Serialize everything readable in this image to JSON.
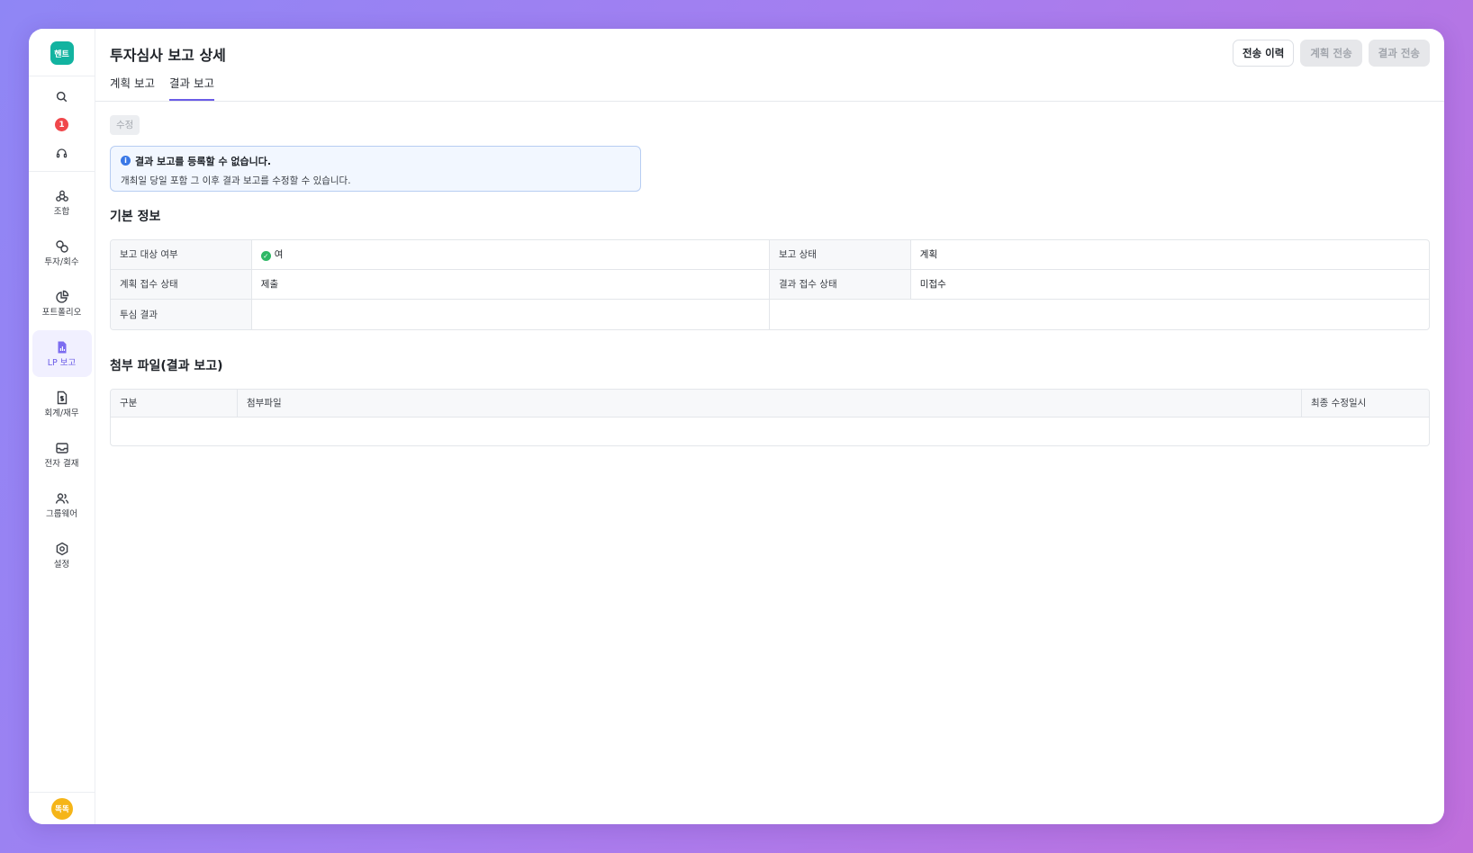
{
  "app": {
    "logo_text": "헨트",
    "notification_count": "1",
    "avatar_text": "똑똑",
    "accent_color": "#6b5ce7",
    "logo_color": "#12b3a0"
  },
  "sidebar": {
    "util_icons": [
      "search-icon",
      "notification-badge",
      "headset-icon"
    ],
    "items": [
      {
        "label": "조합",
        "icon": "union-icon"
      },
      {
        "label": "투자/회수",
        "icon": "investment-icon"
      },
      {
        "label": "포트폴리오",
        "icon": "pie-chart-icon"
      },
      {
        "label": "LP 보고",
        "icon": "report-icon",
        "active": true
      },
      {
        "label": "회계/재무",
        "icon": "accounting-icon"
      },
      {
        "label": "전자 결재",
        "icon": "inbox-icon"
      },
      {
        "label": "그룹웨어",
        "icon": "users-icon"
      },
      {
        "label": "설정",
        "icon": "gear-icon"
      }
    ]
  },
  "header": {
    "title": "투자심사 보고 상세",
    "tabs": [
      {
        "label": "계획 보고",
        "active": false
      },
      {
        "label": "결과 보고",
        "active": true
      }
    ],
    "actions": {
      "history": "전송 이력",
      "plan_send": "계획 전송",
      "result_send": "결과 전송"
    }
  },
  "content": {
    "edit_label": "수정",
    "notice": {
      "title": "결과 보고를 등록할 수 없습니다.",
      "text": "개최일 당일 포함 그 이후 결과 보고를 수정할 수 있습니다."
    },
    "basic_info": {
      "title": "기본 정보",
      "rows": [
        {
          "label1": "보고 대상 여부",
          "value1": "여",
          "label2": "보고 상태",
          "value2": "계획"
        },
        {
          "label1": "계획 접수 상태",
          "value1": "제출",
          "label2": "결과 접수 상태",
          "value2": "미접수"
        },
        {
          "label1": "투심 결과",
          "value1": ""
        }
      ]
    },
    "attachments": {
      "title": "첨부 파일(결과 보고)",
      "columns": [
        "구분",
        "첨부파일",
        "최종 수정일시"
      ]
    }
  }
}
